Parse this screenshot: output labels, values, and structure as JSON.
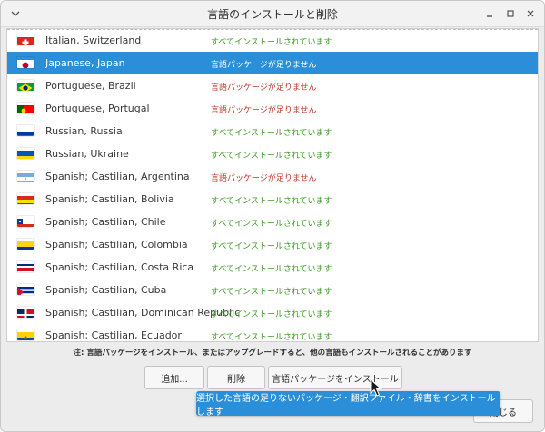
{
  "window": {
    "title": "言語のインストールと削除"
  },
  "titlebar": {
    "menu_icon": "chevron-down-icon",
    "minimize_icon": "minimize-icon",
    "maximize_icon": "maximize-icon",
    "close_icon": "close-icon"
  },
  "languages": [
    {
      "name": "Italian, Switzerland",
      "status": "すべてインストールされています",
      "state": "ok",
      "flag": "switzerland"
    },
    {
      "name": "Japanese, Japan",
      "status": "言語パッケージが足りません",
      "state": "missing",
      "flag": "japan",
      "selected": true
    },
    {
      "name": "Portuguese, Brazil",
      "status": "言語パッケージが足りません",
      "state": "missing",
      "flag": "brazil"
    },
    {
      "name": "Portuguese, Portugal",
      "status": "言語パッケージが足りません",
      "state": "missing",
      "flag": "portugal"
    },
    {
      "name": "Russian, Russia",
      "status": "すべてインストールされています",
      "state": "ok",
      "flag": "russia"
    },
    {
      "name": "Russian, Ukraine",
      "status": "すべてインストールされています",
      "state": "ok",
      "flag": "ukraine"
    },
    {
      "name": "Spanish; Castilian, Argentina",
      "status": "言語パッケージが足りません",
      "state": "missing",
      "flag": "argentina"
    },
    {
      "name": "Spanish; Castilian, Bolivia",
      "status": "すべてインストールされています",
      "state": "ok",
      "flag": "bolivia"
    },
    {
      "name": "Spanish; Castilian, Chile",
      "status": "すべてインストールされています",
      "state": "ok",
      "flag": "chile"
    },
    {
      "name": "Spanish; Castilian, Colombia",
      "status": "すべてインストールされています",
      "state": "ok",
      "flag": "colombia"
    },
    {
      "name": "Spanish; Castilian, Costa Rica",
      "status": "すべてインストールされています",
      "state": "ok",
      "flag": "costa-rica"
    },
    {
      "name": "Spanish; Castilian, Cuba",
      "status": "すべてインストールされています",
      "state": "ok",
      "flag": "cuba"
    },
    {
      "name": "Spanish; Castilian, Dominican Republic",
      "status": "すべてインストールされています",
      "state": "ok",
      "flag": "dominican-republic"
    },
    {
      "name": "Spanish; Castilian, Ecuador",
      "status": "すべてインストールされています",
      "state": "ok",
      "flag": "ecuador"
    }
  ],
  "note": "注: 言語パッケージをインストール、またはアップグレードすると、他の言語もインストールされることがあります",
  "buttons": {
    "add": "追加...",
    "remove": "削除",
    "install": "言語パッケージをインストール",
    "close": "閉じる"
  },
  "tooltip": "選択した言語の足りないパッケージ・翻訳ファイル・辞書をインストールします",
  "colors": {
    "selection": "#2a8fd8",
    "ok": "#3a9a24",
    "missing": "#c0392b"
  }
}
